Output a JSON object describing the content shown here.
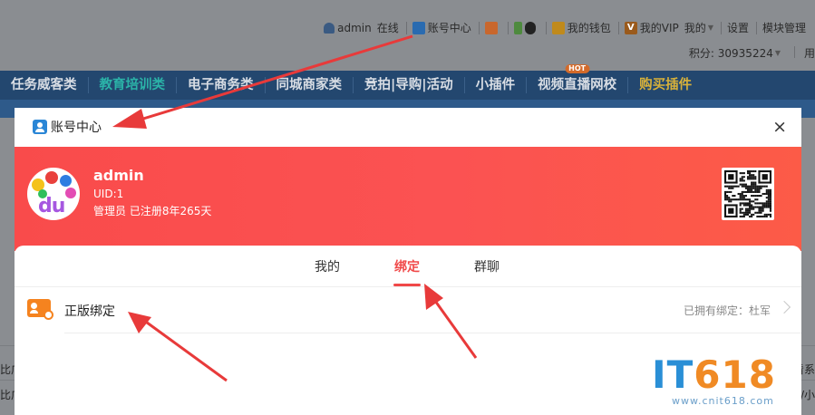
{
  "topbar": {
    "username": "admin",
    "online": "在线",
    "account_center": "账号中心",
    "wallet": "我的钱包",
    "vip": "我的VIP",
    "vip_badge": "V",
    "mine": "我的",
    "settings": "设置",
    "module_admin": "模块管理",
    "score": "积分: 30935224",
    "edge_text": "用"
  },
  "nav": {
    "items": [
      {
        "label": "任务威客类"
      },
      {
        "label": "教育培训类"
      },
      {
        "label": "电子商务类"
      },
      {
        "label": "同城商家类"
      },
      {
        "label": "竞拍|导购|活动"
      },
      {
        "label": "小插件"
      },
      {
        "label": "视频直播网校",
        "badge": "HOT"
      },
      {
        "label": "购买插件"
      }
    ]
  },
  "background": {
    "left_1": "比广",
    "left_2": "比广",
    "right_1": "看系",
    "right_2": "万/小"
  },
  "modal": {
    "title": "账号中心",
    "close": "×",
    "user": {
      "name": "admin",
      "uid": "UID:1",
      "role": "管理员 已注册8年265天",
      "avatar_text": "du"
    },
    "tabs": [
      {
        "label": "我的"
      },
      {
        "label": "绑定",
        "active": true
      },
      {
        "label": "群聊"
      }
    ],
    "rows": [
      {
        "label": "正版绑定",
        "status": "已拥有绑定：杜军"
      }
    ]
  },
  "watermark": {
    "it": "IT",
    "num": "618",
    "url": "www.cnit618.com"
  },
  "colors": {
    "accent_red": "#f04848",
    "nav_bg": "#23476f",
    "nav_active": "#2bb3a8",
    "nav_gold": "#d8b13a",
    "arrow_red": "#e83a3a"
  },
  "icons": [
    "user-icon",
    "account-icon",
    "qq-icon",
    "wallet-icon",
    "vip-icon",
    "close-icon",
    "qr-code-icon",
    "bind-icon",
    "chevron-right-icon"
  ]
}
